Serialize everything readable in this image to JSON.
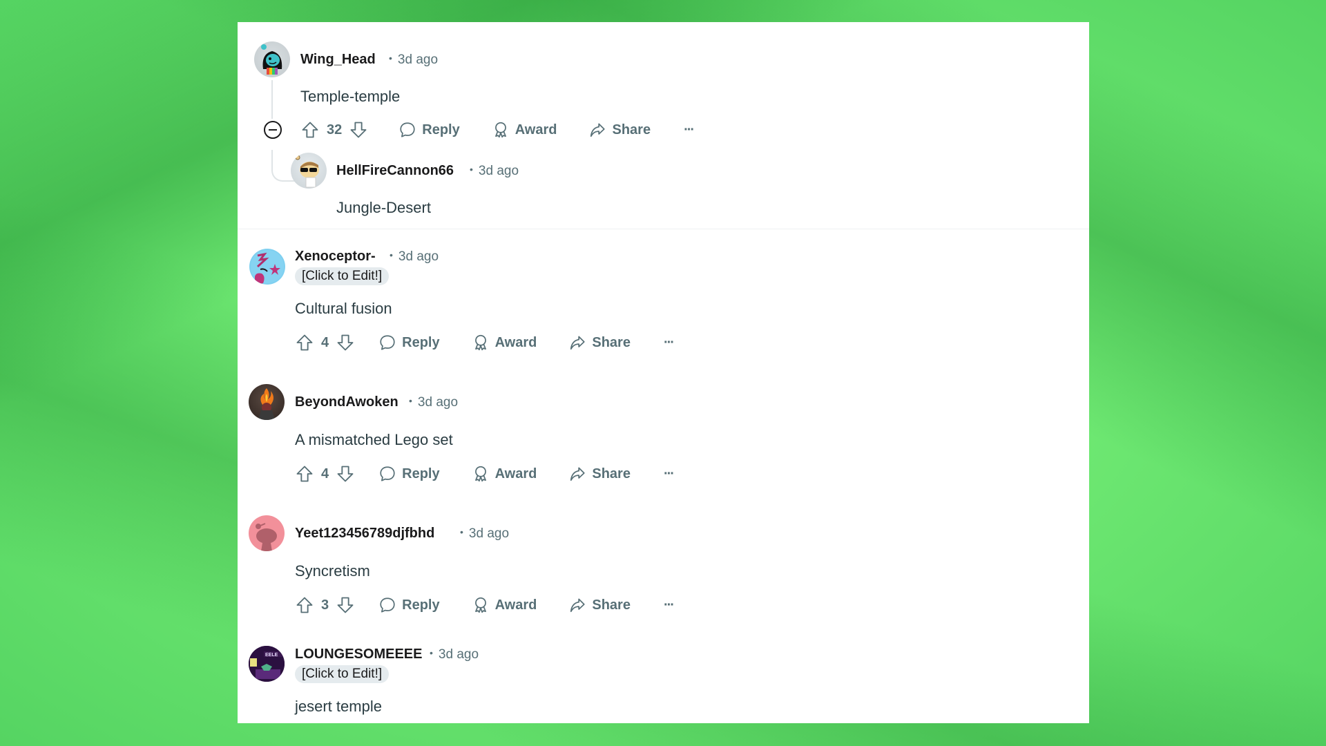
{
  "comments": [
    {
      "username": "Wing_Head",
      "time": "3d ago",
      "separator": "•",
      "body": "Temple-temple",
      "votes": "32",
      "avatar": "teal-monster-avatar",
      "collapse_icon": "collapse-thread-icon"
    },
    {
      "username": "HellFireCannon66",
      "time": "3d ago",
      "separator": "•",
      "body": "Jungle-Desert",
      "avatar": "sunglasses-snoo-avatar",
      "is_reply": true
    },
    {
      "username": "Xenoceptor-",
      "time": "3d ago",
      "separator": "•",
      "flair": "[Click to Edit!]",
      "body": "Cultural fusion",
      "votes": "4",
      "avatar": "thinking-emoji-avatar"
    },
    {
      "username": "BeyondAwoken",
      "time": "3d ago",
      "separator": "•",
      "body": "A mismatched Lego set",
      "votes": "4",
      "avatar": "fire-avatar"
    },
    {
      "username": "Yeet123456789djfbhd",
      "time": "3d ago",
      "separator": "•",
      "body": "Syncretism",
      "votes": "3",
      "avatar": "default-snoo-avatar"
    },
    {
      "username": "LOUNGESOMEEEE",
      "time": "3d ago",
      "separator": "•",
      "flair": "[Click to Edit!]",
      "body": "jesert temple",
      "avatar": "purple-game-avatar"
    }
  ],
  "actions": {
    "reply": "Reply",
    "award": "Award",
    "share": "Share",
    "more": "···"
  },
  "colors": {
    "background": "#6ee872",
    "panel": "#ffffff",
    "username": "#1a1a1b",
    "meta": "#576f76",
    "flair_bg": "#e5ebee"
  }
}
